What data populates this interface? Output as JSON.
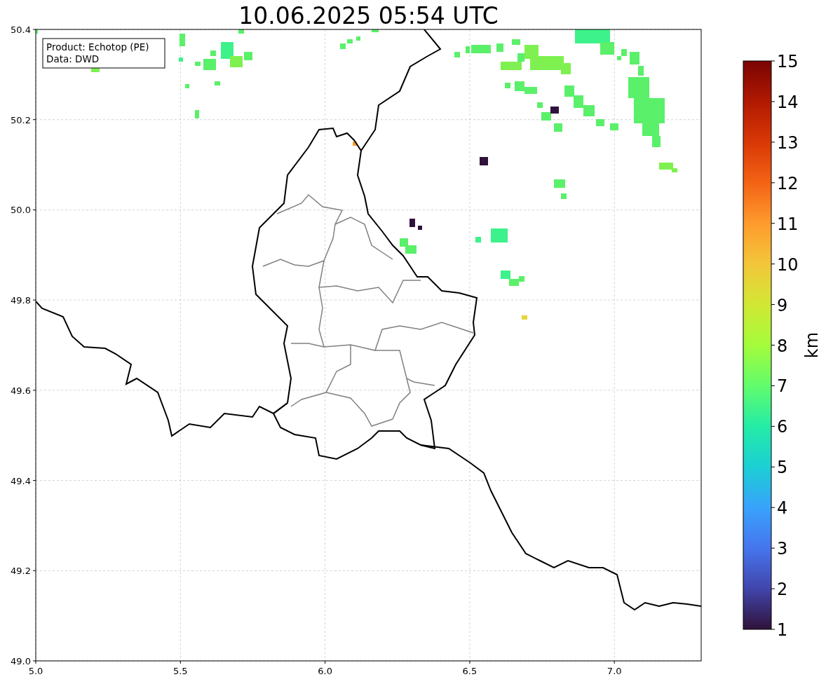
{
  "title": "10.06.2025 05:54 UTC",
  "annotation": [
    "Product: Echotop (PE)",
    "Data: DWD"
  ],
  "x_axis": {
    "ticks": [
      "5.0",
      "5.5",
      "6.0",
      "6.5",
      "7.0"
    ]
  },
  "y_axis": {
    "ticks": [
      "50.4",
      "50.2",
      "50.0",
      "49.8",
      "49.6",
      "49.4",
      "49.2",
      "49.0"
    ]
  },
  "colorbar": {
    "label": "km",
    "ticks": [
      "15",
      "14",
      "13",
      "12",
      "11",
      "10",
      "9",
      "8",
      "7",
      "6",
      "5",
      "4",
      "3",
      "2",
      "1"
    ]
  }
}
